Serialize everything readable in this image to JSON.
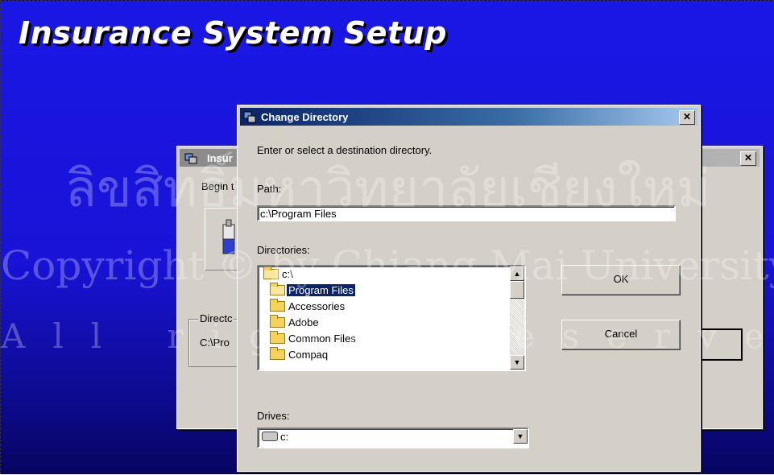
{
  "app": {
    "title": "Insurance System Setup"
  },
  "background_window": {
    "title": "Insur",
    "close_label": "✕",
    "begin_text": "Begin t",
    "directory_group_label": "Directc",
    "directory_value": "C:\\Pro"
  },
  "dialog": {
    "title": "Change Directory",
    "close_label": "✕",
    "instruction": "Enter or select a destination directory.",
    "path_label": "Path:",
    "path_value": "c:\\Program Files",
    "directories_label": "Directories:",
    "directories": [
      {
        "name": "c:\\",
        "icon": "open-folder-icon",
        "indent": 0
      },
      {
        "name": "Program Files",
        "icon": "open-folder-icon",
        "indent": 1,
        "selected": true
      },
      {
        "name": "Accessories",
        "icon": "folder-icon",
        "indent": 2
      },
      {
        "name": "Adobe",
        "icon": "folder-icon",
        "indent": 2
      },
      {
        "name": "Common Files",
        "icon": "folder-icon",
        "indent": 2
      },
      {
        "name": "Compaq",
        "icon": "folder-icon",
        "indent": 2
      }
    ],
    "ok_label": "OK",
    "cancel_label": "Cancel",
    "drives_label": "Drives:",
    "drive_value": "c:"
  },
  "watermark": {
    "line1": "ลิขสิทธิ์มหาวิทยาลัยเชียงใหม่",
    "line2": "Copyright © by Chiang Mai University",
    "line3": "All rights reserved"
  },
  "colors": {
    "desktop_top": "#1a17e6",
    "desktop_bottom": "#07055e",
    "dialog_face": "#d4d0c8",
    "titlebar_active": "#0a246a",
    "selection": "#0a246a"
  }
}
